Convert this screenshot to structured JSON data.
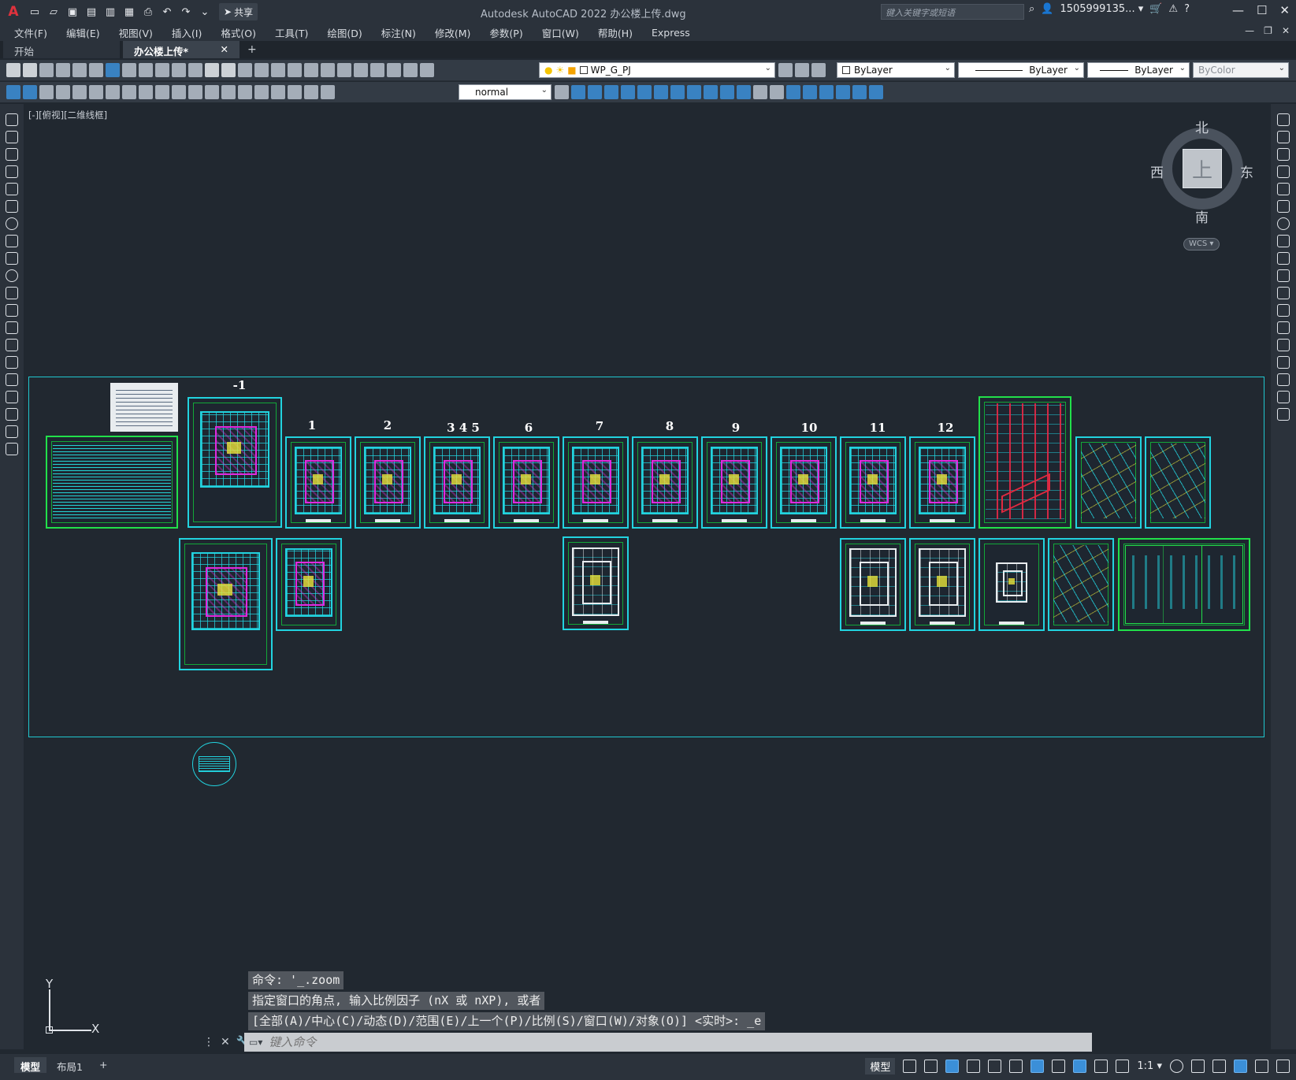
{
  "titlebar": {
    "logo": "A",
    "share_label": "共享",
    "window_title": "Autodesk AutoCAD 2022    办公楼上传.dwg",
    "search_placeholder": "键入关键字或短语",
    "user": "1505999135... ▾",
    "cart_icon": "cart-icon",
    "minimize": "—",
    "maximize": "☐",
    "close": "✕"
  },
  "menu": {
    "items": [
      "文件(F)",
      "编辑(E)",
      "视图(V)",
      "插入(I)",
      "格式(O)",
      "工具(T)",
      "绘图(D)",
      "标注(N)",
      "修改(M)",
      "参数(P)",
      "窗口(W)",
      "帮助(H)",
      "Express"
    ],
    "doc_min": "—",
    "doc_restore": "❐",
    "doc_close": "✕"
  },
  "tabs": {
    "start": "开始",
    "active": "办公楼上传*",
    "close": "✕",
    "add": "+"
  },
  "toolbar": {
    "layer": "WP_G_PJ",
    "color": "ByLayer",
    "linetype": "ByLayer",
    "lineweight": "ByLayer",
    "plotstyle": "ByColor",
    "textstyle": "normal"
  },
  "viewport": {
    "label": "[-][俯视][二维线框]"
  },
  "viewcube": {
    "north": "北",
    "south": "南",
    "east": "东",
    "west": "西",
    "face": "上",
    "wcs": "WCS ▾"
  },
  "drawing": {
    "floor_labels": [
      "-1",
      "1",
      "2",
      "3  4  5",
      "6",
      "7",
      "8",
      "9",
      "10",
      "11",
      "12"
    ]
  },
  "ucs": {
    "x": "X",
    "y": "Y"
  },
  "command": {
    "history": [
      "命令: '_.zoom",
      "指定窗口的角点, 输入比例因子 (nX 或 nXP), 或者",
      "[全部(A)/中心(C)/动态(D)/范围(E)/上一个(P)/比例(S)/窗口(W)/对象(O)] <实时>: _e"
    ],
    "placeholder": "键入命令"
  },
  "status": {
    "layout_tabs": [
      "模型",
      "布局1"
    ],
    "add": "+",
    "model": "模型",
    "scale": "1:1 ▾"
  }
}
